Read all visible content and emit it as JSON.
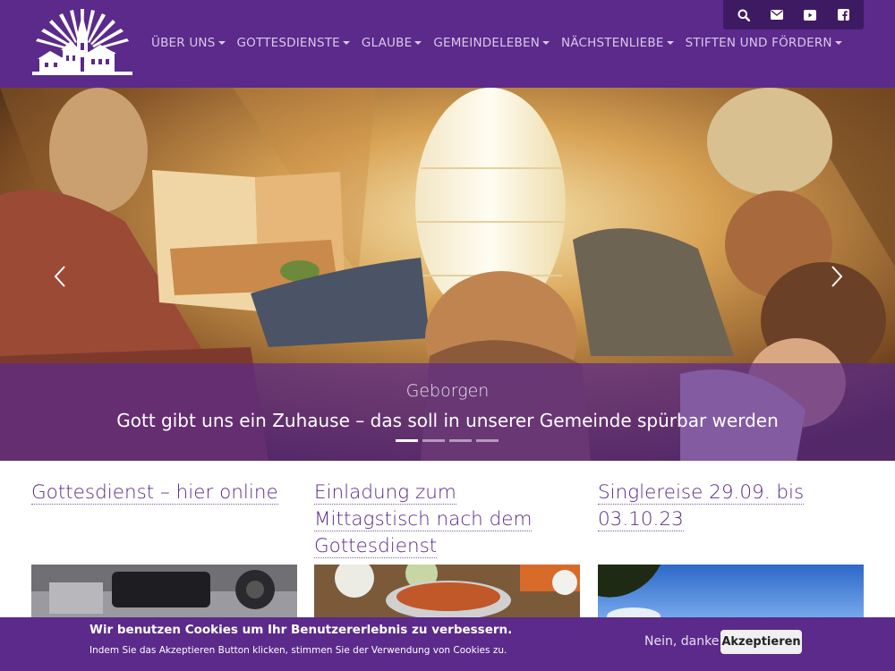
{
  "header": {
    "nav": [
      {
        "label": "ÜBER UNS"
      },
      {
        "label": "GOTTESDIENSTE"
      },
      {
        "label": "GLAUBE"
      },
      {
        "label": "GEMEINDELEBEN"
      },
      {
        "label": "NÄCHSTENLIEBE"
      },
      {
        "label": "STIFTEN UND FÖRDERN"
      }
    ],
    "icons": [
      "search-icon",
      "envelope-icon",
      "youtube-icon",
      "facebook-icon"
    ]
  },
  "hero": {
    "title": "Geborgen",
    "text": "Gott gibt uns ein Zuhause – das soll in unserer Gemeinde spürbar werden",
    "slides": 4,
    "active_slide": 1
  },
  "teasers": [
    {
      "title": "Gottesdienst – hier online"
    },
    {
      "title": "Einladung zum Mittagstisch nach dem Gottesdienst"
    },
    {
      "title": "Singlereise 29.09. bis 03.10.23"
    }
  ],
  "cookie": {
    "title": "Wir benutzen Cookies um Ihr Benutzererlebnis zu verbessern.",
    "text": "Indem Sie das Akzeptieren Button klicken, stimmen Sie der Verwendung von Cookies zu.",
    "decline": "Nein, danke",
    "accept": "Akzeptieren"
  },
  "colors": {
    "brand": "#5b2a8a",
    "brand_dark": "#3e1a63"
  }
}
